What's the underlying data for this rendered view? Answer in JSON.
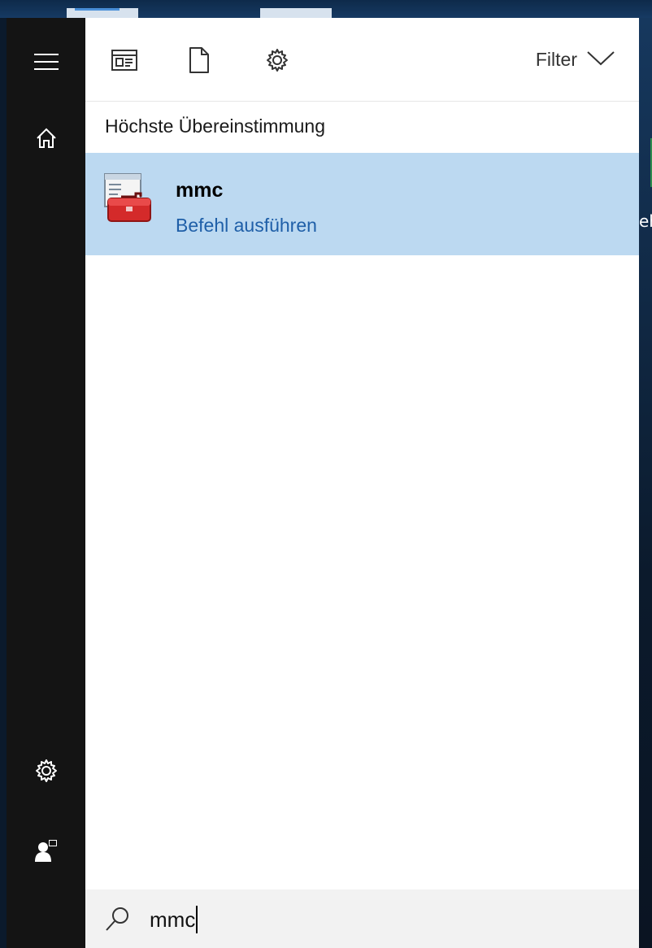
{
  "toolbar": {
    "icons": [
      "apps-icon",
      "document-icon",
      "settings-icon"
    ],
    "filter_label": "Filter"
  },
  "rail": {
    "icons": [
      "hamburger-menu-icon",
      "home-icon",
      "settings-icon",
      "user-account-icon"
    ]
  },
  "results": {
    "section_title": "Höchste Übereinstimmung",
    "best_match": {
      "title": "mmc",
      "subtitle": "Befehl ausführen",
      "icon": "toolbox-icon"
    }
  },
  "search": {
    "value": "mmc",
    "icon": "search-icon"
  },
  "desktop": {
    "edge_text": "eh"
  },
  "colors": {
    "selection": "#bcd9f1",
    "accent_text": "#1f5fa8",
    "rail": "#141414"
  }
}
